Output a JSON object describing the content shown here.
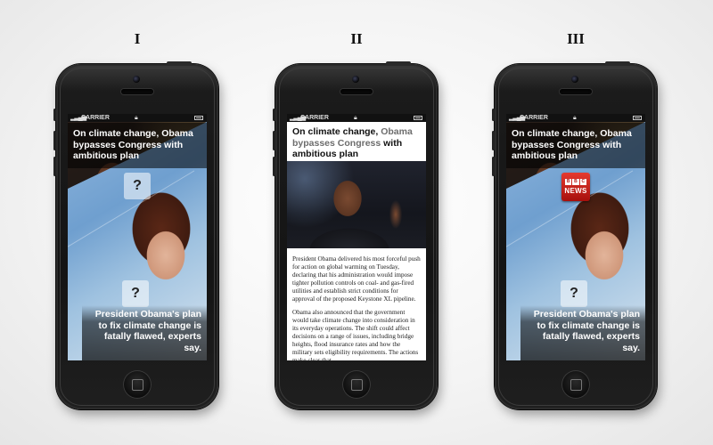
{
  "panels": [
    {
      "label": "I",
      "status": {
        "carrier": "CARRIER"
      },
      "top_headline": "On climate change, Obama bypasses Congress with ambitious plan",
      "top_badge": "?",
      "bottom_badge": "?",
      "bottom_headline": "President Obama's plan to fix climate change is fatally flawed, experts say."
    },
    {
      "label": "II",
      "status": {
        "carrier": "CARRIER"
      },
      "headline_part1": "On climate change, ",
      "headline_part2": "Obama bypasses Congress ",
      "headline_part3": "with ambitious plan",
      "paragraphs": [
        "President Obama delivered his most forceful push for action on global warming on Tuesday, declaring that his administration would impose tighter pollution controls on coal- and gas-fired utilities and establish strict conditions for approval of the proposed Keystone XL pipeline.",
        "Obama also announced that the government would take climate change into consideration in its everyday operations. The shift could affect decisions on a range of issues, including bridge heights, flood insurance rates and how the military sets eligibility requirements. The actions make clear that"
      ]
    },
    {
      "label": "III",
      "status": {
        "carrier": "CARRIER"
      },
      "top_headline": "On climate change, Obama bypasses Congress with ambitious plan",
      "brand_badge": {
        "blocks": [
          "B",
          "B",
          "C"
        ],
        "text": "NEWS",
        "color": "#c4160f"
      },
      "bottom_badge": "?",
      "bottom_headline": "President Obama's plan to fix climate change is fatally flawed, experts say."
    }
  ]
}
